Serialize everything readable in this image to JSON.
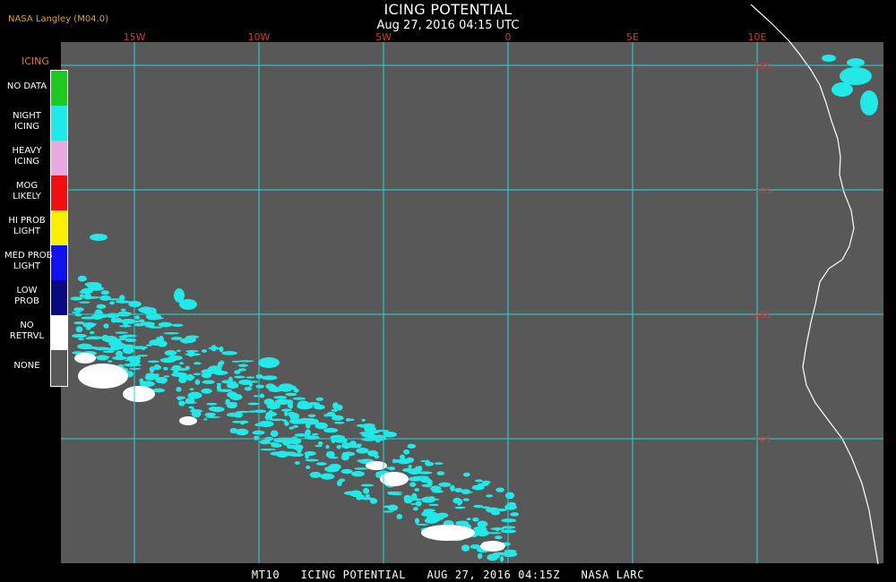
{
  "header": {
    "producer": "NASA Langley (M04.0)",
    "title": "ICING POTENTIAL",
    "subtitle": "Aug 27, 2016 04:15 UTC"
  },
  "map": {
    "background_color": "#585858",
    "grid_color": "#22d8d8",
    "longitudes": [
      {
        "label": "15W",
        "deg": -15
      },
      {
        "label": "10W",
        "deg": -10
      },
      {
        "label": "5W",
        "deg": -5
      },
      {
        "label": "0",
        "deg": 0
      },
      {
        "label": "5E",
        "deg": 5
      },
      {
        "label": "10E",
        "deg": 10
      }
    ],
    "latitudes": [
      {
        "label": "15S",
        "deg": -15
      },
      {
        "label": "20S",
        "deg": -20
      },
      {
        "label": "25S",
        "deg": -25
      },
      {
        "label": "30S",
        "deg": -30
      }
    ]
  },
  "legend": {
    "title": "ICING",
    "items": [
      {
        "label": "NO DATA",
        "color": "#1ec81e"
      },
      {
        "label": "NIGHT\nICING",
        "color": "#22e8e8"
      },
      {
        "label": "HEAVY\nICING",
        "color": "#e8a8e0"
      },
      {
        "label": "MOG\nLIKELY",
        "color": "#ee1010"
      },
      {
        "label": "HI PROB\nLIGHT",
        "color": "#f8f000"
      },
      {
        "label": "MED PROB\nLIGHT",
        "color": "#1010f0"
      },
      {
        "label": "LOW\nPROB",
        "color": "#0a0a80"
      },
      {
        "label": "NO\nRETRVL",
        "color": "#ffffff"
      },
      {
        "label": "NONE",
        "color": "#585858"
      }
    ]
  },
  "footer": {
    "text": "MT10   ICING POTENTIAL   AUG 27, 2016 04:15Z   NASA LARC"
  }
}
